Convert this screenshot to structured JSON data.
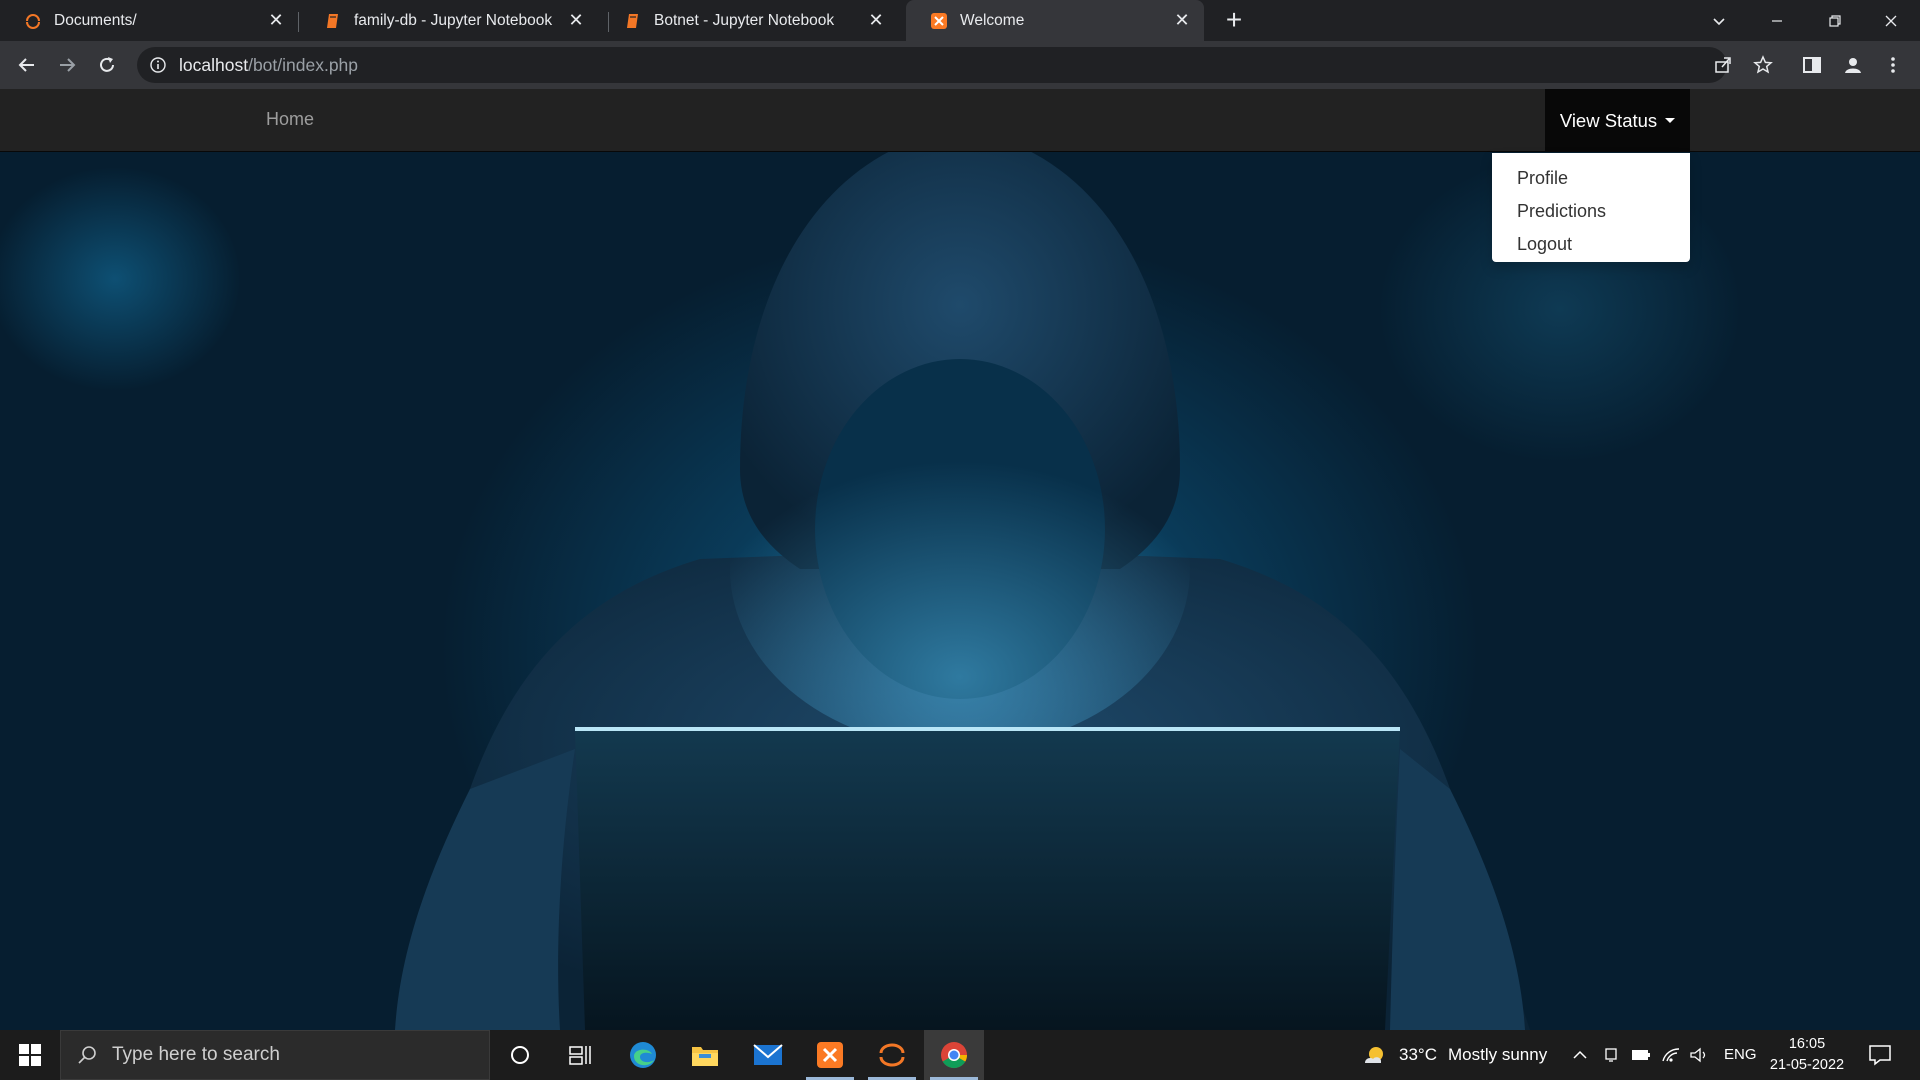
{
  "browser": {
    "tabs": [
      {
        "title": "Documents/",
        "icon": "jupyter-logo-icon"
      },
      {
        "title": "family-db - Jupyter Notebook",
        "icon": "notebook-icon"
      },
      {
        "title": "Botnet - Jupyter Notebook",
        "icon": "notebook-icon"
      },
      {
        "title": "Welcome",
        "icon": "xampp-icon",
        "active": true
      }
    ],
    "address": {
      "host": "localhost",
      "path": "/bot/index.php"
    }
  },
  "page": {
    "nav": {
      "home_label": "Home",
      "status_label": "View Status",
      "dropdown": [
        "Profile",
        "Predictions",
        "Logout"
      ]
    },
    "hero_image": "hooded-hacker-with-laptop"
  },
  "taskbar": {
    "search_placeholder": "Type here to search",
    "apps": [
      "cortana-icon",
      "task-view-icon",
      "edge-icon",
      "file-explorer-icon",
      "mail-icon",
      "xampp-icon",
      "jupyter-icon",
      "chrome-icon"
    ],
    "weather": {
      "temp": "33°C",
      "condition": "Mostly sunny"
    },
    "language": "ENG",
    "time": "16:05",
    "date": "21-05-2022"
  },
  "colors": {
    "accent": "#0a3d5c",
    "navbar": "#222222",
    "tab_bg": "#202124",
    "toolbar_bg": "#35363a"
  }
}
